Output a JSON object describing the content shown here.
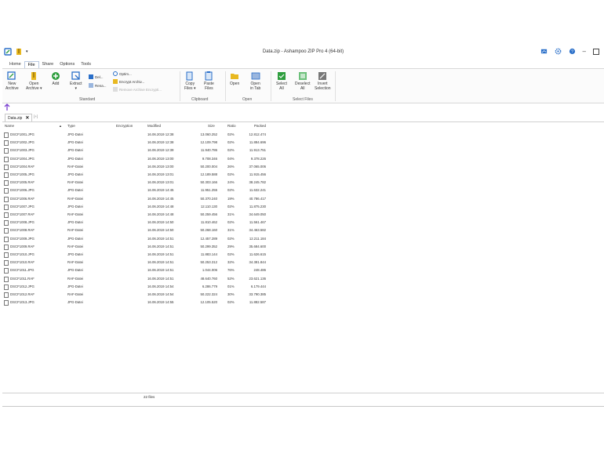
{
  "window": {
    "title": "Data.zip - Ashampoo ZIP Pro 4 (64-bit)"
  },
  "menu": [
    "Home",
    "File",
    "Share",
    "Options",
    "Tools"
  ],
  "menu_active": "File",
  "ribbon": {
    "standard": {
      "label": "Standard",
      "new_archive": "New\nArchive",
      "open_archive": "Open\nArchive ▾",
      "add": "Add",
      "extract": "Extract\n▾",
      "delete": "Del...",
      "rename": "Rena...",
      "optimize": "Optim...",
      "encrypt": "Encrypt Archiv...",
      "remove_encrypt": "Remove Archive Encrypti..."
    },
    "clipboard": {
      "label": "Clipboard",
      "copy": "Copy\nFiles ▾",
      "paste": "Paste\nFiles"
    },
    "open": {
      "label": "Open",
      "open": "Open",
      "open_tab": "Open\nin Tab"
    },
    "select": {
      "label": "Select Files",
      "select_all": "Select\nAll",
      "deselect_all": "Deselect\nAll",
      "invert": "Invert\nSelection"
    }
  },
  "tabs": {
    "current": "Data.zip",
    "new_tab": "[+]"
  },
  "columns": [
    "Name",
    "Type",
    "Encryption",
    "Modified",
    "Size",
    "Ratio",
    "Packed"
  ],
  "rows": [
    [
      "DSCF1001.JPG",
      "JPG-Datei",
      "",
      "16.06.2019 12:38",
      "13.060.252",
      "02%",
      "12.812.474"
    ],
    [
      "DSCF1002.JPG",
      "JPG-Datei",
      "",
      "16.06.2019 12:38",
      "12.109.798",
      "02%",
      "11.884.696"
    ],
    [
      "DSCF1003.JPG",
      "JPG-Datei",
      "",
      "16.06.2019 12:39",
      "11.940.786",
      "02%",
      "11.913.751"
    ],
    [
      "DSCF1004.JPG",
      "JPG-Datei",
      "",
      "16.06.2019 13:00",
      "9.708.346",
      "04%",
      "9.378.226"
    ],
    [
      "DSCF1004.RAF",
      "RAF-Datei",
      "",
      "16.06.2019 13:00",
      "50.200.004",
      "26%",
      "37.065.006"
    ],
    [
      "DSCF1005.JPG",
      "JPG-Datei",
      "",
      "16.06.2019 13:01",
      "12.189.588",
      "02%",
      "11.915.456"
    ],
    [
      "DSCF1005.RAF",
      "RAF-Datei",
      "",
      "16.06.2019 13:01",
      "50.303.166",
      "24%",
      "38.245.782"
    ],
    [
      "DSCF1006.JPG",
      "JPG-Datei",
      "",
      "16.06.2019 14:45",
      "11.951.255",
      "02%",
      "11.632.241"
    ],
    [
      "DSCF1006.RAF",
      "RAF-Datei",
      "",
      "16.06.2019 14:45",
      "50.370.240",
      "19%",
      "40.786.417"
    ],
    [
      "DSCF1007.JPG",
      "JPG-Datei",
      "",
      "16.06.2019 14:48",
      "12.110.130",
      "02%",
      "11.875.230"
    ],
    [
      "DSCF1007.RAF",
      "RAF-Datei",
      "",
      "16.06.2019 14:48",
      "50.259.456",
      "31%",
      "34.649.050"
    ],
    [
      "DSCF1008.JPG",
      "JPG-Datei",
      "",
      "16.06.2019 14:50",
      "11.810.462",
      "02%",
      "11.561.467"
    ],
    [
      "DSCF1008.RAF",
      "RAF-Datei",
      "",
      "16.06.2019 14:50",
      "50.268.160",
      "31%",
      "34.463.582"
    ],
    [
      "DSCF1009.JPG",
      "JPG-Datei",
      "",
      "16.06.2019 14:51",
      "12.457.289",
      "02%",
      "12.211.184"
    ],
    [
      "DSCF1009.RAF",
      "RAF-Datei",
      "",
      "16.06.2019 14:51",
      "50.299.352",
      "29%",
      "35.684.600"
    ],
    [
      "DSCF1010.JPG",
      "JPG-Datei",
      "",
      "16.06.2019 14:51",
      "11.883.144",
      "02%",
      "11.626.615"
    ],
    [
      "DSCF1010.RAF",
      "RAF-Datei",
      "",
      "16.06.2019 14:51",
      "50.253.312",
      "32%",
      "34.381.844"
    ],
    [
      "DSCF1011.JPG",
      "JPG-Datei",
      "",
      "16.06.2019 14:51",
      "1.044.006",
      "76%",
      "248.486"
    ],
    [
      "DSCF1011.RAF",
      "RAF-Datei",
      "",
      "16.06.2019 14:51",
      "48.640.760",
      "52%",
      "23.621.136"
    ],
    [
      "DSCF1012.JPG",
      "JPG-Datei",
      "",
      "16.06.2019 14:54",
      "6.286.779",
      "01%",
      "6.179.444"
    ],
    [
      "DSCF1012.RAF",
      "RAF-Datei",
      "",
      "16.06.2019 14:54",
      "50.222.324",
      "30%",
      "33.790.385"
    ],
    [
      "DSCF1013.JPG",
      "JPG-Datei",
      "",
      "16.06.2019 14:55",
      "12.105.520",
      "02%",
      "11.882.587"
    ]
  ],
  "status": {
    "count": "22 files"
  },
  "colors": {
    "accent": "#2a6fc9",
    "green": "#2e9e3e",
    "yellow": "#e8b820",
    "purple": "#7a3fd0"
  }
}
